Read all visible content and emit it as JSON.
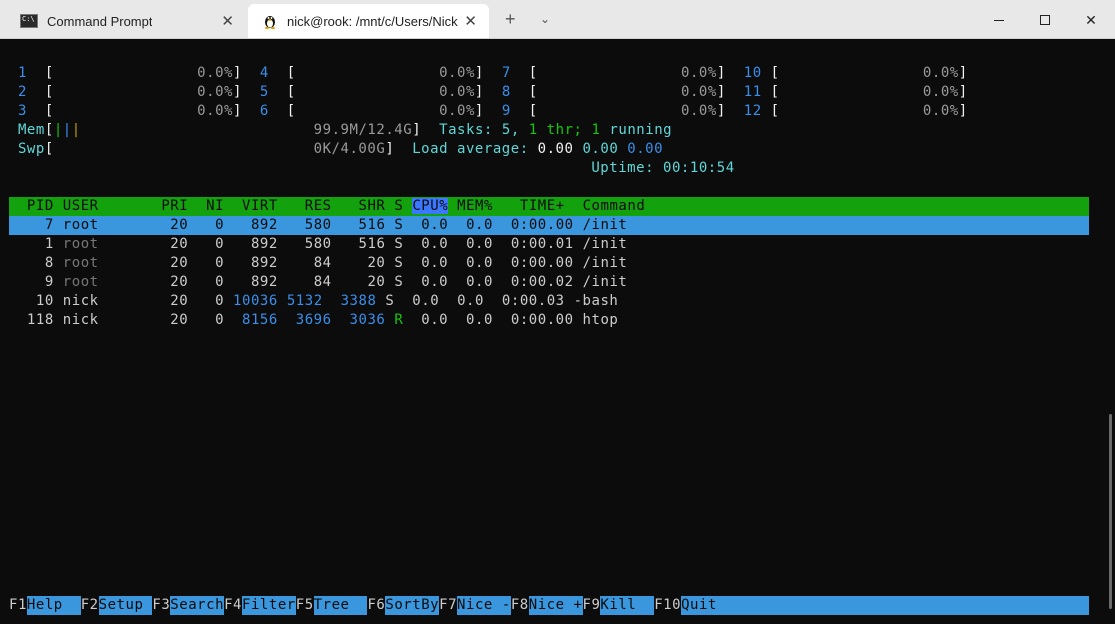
{
  "window": {
    "tabs": [
      {
        "title": "Command Prompt",
        "icon": "cmd-icon",
        "active": false
      },
      {
        "title": "nick@rook: /mnt/c/Users/Nick",
        "icon": "tux-icon",
        "active": true
      }
    ]
  },
  "cpu_meters": [
    {
      "id": "1",
      "pct": "0.0%"
    },
    {
      "id": "2",
      "pct": "0.0%"
    },
    {
      "id": "3",
      "pct": "0.0%"
    },
    {
      "id": "4",
      "pct": "0.0%"
    },
    {
      "id": "5",
      "pct": "0.0%"
    },
    {
      "id": "6",
      "pct": "0.0%"
    },
    {
      "id": "7",
      "pct": "0.0%"
    },
    {
      "id": "8",
      "pct": "0.0%"
    },
    {
      "id": "9",
      "pct": "0.0%"
    },
    {
      "id": "10",
      "pct": "0.0%"
    },
    {
      "id": "11",
      "pct": "0.0%"
    },
    {
      "id": "12",
      "pct": "0.0%"
    }
  ],
  "memory": {
    "label": "Mem",
    "value": "99.9M/12.4G"
  },
  "swap": {
    "label": "Swp",
    "value": "0K/4.00G"
  },
  "tasks": {
    "label": "Tasks:",
    "count": "5",
    "thr": "1",
    "thr_label": "thr;",
    "running": "1",
    "running_label": "running"
  },
  "load": {
    "label": "Load average:",
    "v1": "0.00",
    "v2": "0.00",
    "v3": "0.00"
  },
  "uptime": {
    "label": "Uptime:",
    "value": "00:10:54"
  },
  "columns": [
    "PID",
    "USER",
    "PRI",
    "NI",
    "VIRT",
    "RES",
    "SHR",
    "S",
    "CPU%",
    "MEM%",
    "TIME+",
    "Command"
  ],
  "processes": [
    {
      "pid": "7",
      "user": "root",
      "pri": "20",
      "ni": "0",
      "virt": "892",
      "res": "580",
      "shr": "516",
      "s": "S",
      "cpu": "0.0",
      "mem": "0.0",
      "time": "0:00.00",
      "cmd": "/init"
    },
    {
      "pid": "1",
      "user": "root",
      "pri": "20",
      "ni": "0",
      "virt": "892",
      "res": "580",
      "shr": "516",
      "s": "S",
      "cpu": "0.0",
      "mem": "0.0",
      "time": "0:00.01",
      "cmd": "/init"
    },
    {
      "pid": "8",
      "user": "root",
      "pri": "20",
      "ni": "0",
      "virt": "892",
      "res": "84",
      "shr": "20",
      "s": "S",
      "cpu": "0.0",
      "mem": "0.0",
      "time": "0:00.00",
      "cmd": "/init"
    },
    {
      "pid": "9",
      "user": "root",
      "pri": "20",
      "ni": "0",
      "virt": "892",
      "res": "84",
      "shr": "20",
      "s": "S",
      "cpu": "0.0",
      "mem": "0.0",
      "time": "0:00.02",
      "cmd": "/init"
    },
    {
      "pid": "10",
      "user": "nick",
      "pri": "20",
      "ni": "0",
      "virt": "10036",
      "res": "5132",
      "shr": "3388",
      "s": "S",
      "cpu": "0.0",
      "mem": "0.0",
      "time": "0:00.03",
      "cmd": "-bash"
    },
    {
      "pid": "118",
      "user": "nick",
      "pri": "20",
      "ni": "0",
      "virt": "8156",
      "res": "3696",
      "shr": "3036",
      "s": "R",
      "cpu": "0.0",
      "mem": "0.0",
      "time": "0:00.00",
      "cmd": "htop"
    }
  ],
  "function_keys": [
    {
      "key": "F1",
      "label": "Help  "
    },
    {
      "key": "F2",
      "label": "Setup "
    },
    {
      "key": "F3",
      "label": "Search"
    },
    {
      "key": "F4",
      "label": "Filter"
    },
    {
      "key": "F5",
      "label": "Tree  "
    },
    {
      "key": "F6",
      "label": "SortBy"
    },
    {
      "key": "F7",
      "label": "Nice -"
    },
    {
      "key": "F8",
      "label": "Nice +"
    },
    {
      "key": "F9",
      "label": "Kill  "
    },
    {
      "key": "F10",
      "label": "Quit"
    }
  ]
}
